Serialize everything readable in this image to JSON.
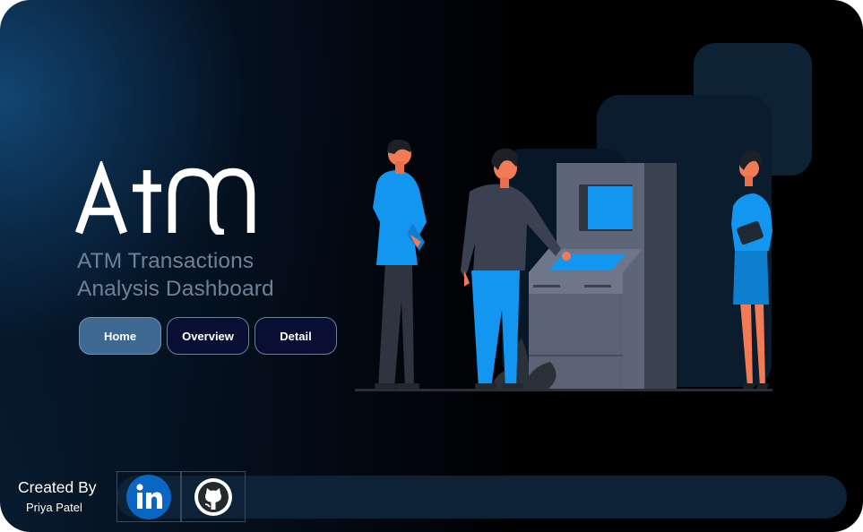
{
  "logo": {
    "text": "ATM"
  },
  "subtitle": {
    "line1": "ATM Transactions",
    "line2": "Analysis Dashboard"
  },
  "nav": {
    "home": "Home",
    "overview": "Overview",
    "detail": "Detail"
  },
  "footer": {
    "created_by": "Created By",
    "author": "Priya Patel"
  },
  "social": {
    "linkedin_icon": "linkedin-icon",
    "github_icon": "github-icon"
  },
  "colors": {
    "background": "#000000",
    "accent_blue": "#1296f0",
    "home_button": "#3c6891",
    "nav_button": "#080f33",
    "subtitle": "#6c8397",
    "footer_bar": "#0d2137"
  }
}
